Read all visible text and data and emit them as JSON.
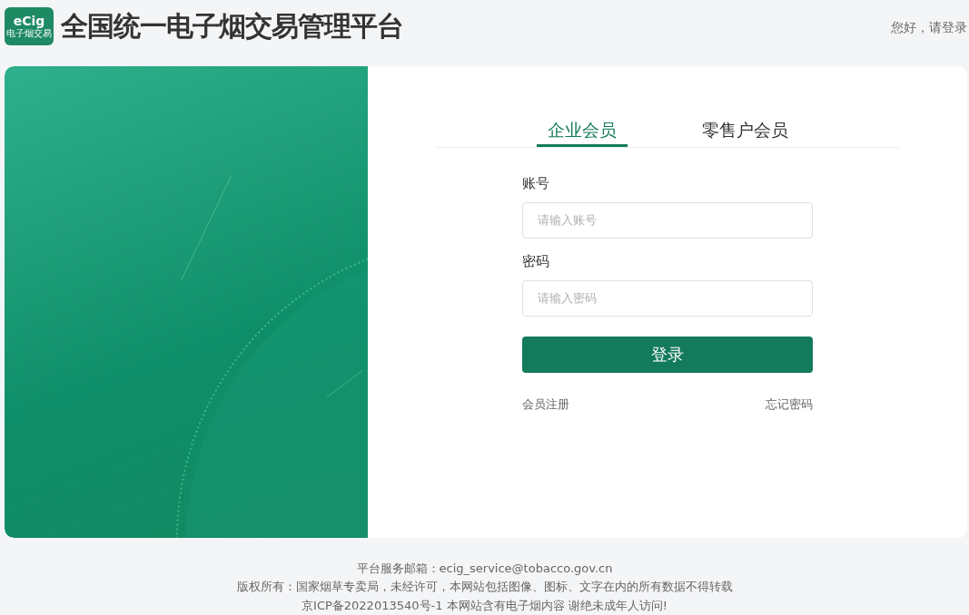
{
  "header": {
    "logo": {
      "mark": "eCig",
      "caption": "电子烟交易"
    },
    "title": "全国统一电子烟交易管理平台",
    "greeting": "您好，请登录"
  },
  "tabs": [
    {
      "label": "企业会员",
      "selected": true
    },
    {
      "label": "零售户会员",
      "selected": false
    }
  ],
  "form": {
    "fields": [
      {
        "label": "账号",
        "placeholder": "请输入账号"
      },
      {
        "label": "密码",
        "placeholder": "请输入密码"
      }
    ],
    "submit": "登录",
    "links": [
      "会员注册",
      "忘记密码"
    ]
  },
  "footer": [
    "平台服务邮箱：ecig_service@tobacco.gov.cn",
    "版权所有：国家烟草专卖局，未经许可，本网站包括图像、图标、文字在内的所有数据不得转载",
    "京ICP备2022013540号-1 本网站含有电子烟内容 谢绝未成年人访问!"
  ]
}
